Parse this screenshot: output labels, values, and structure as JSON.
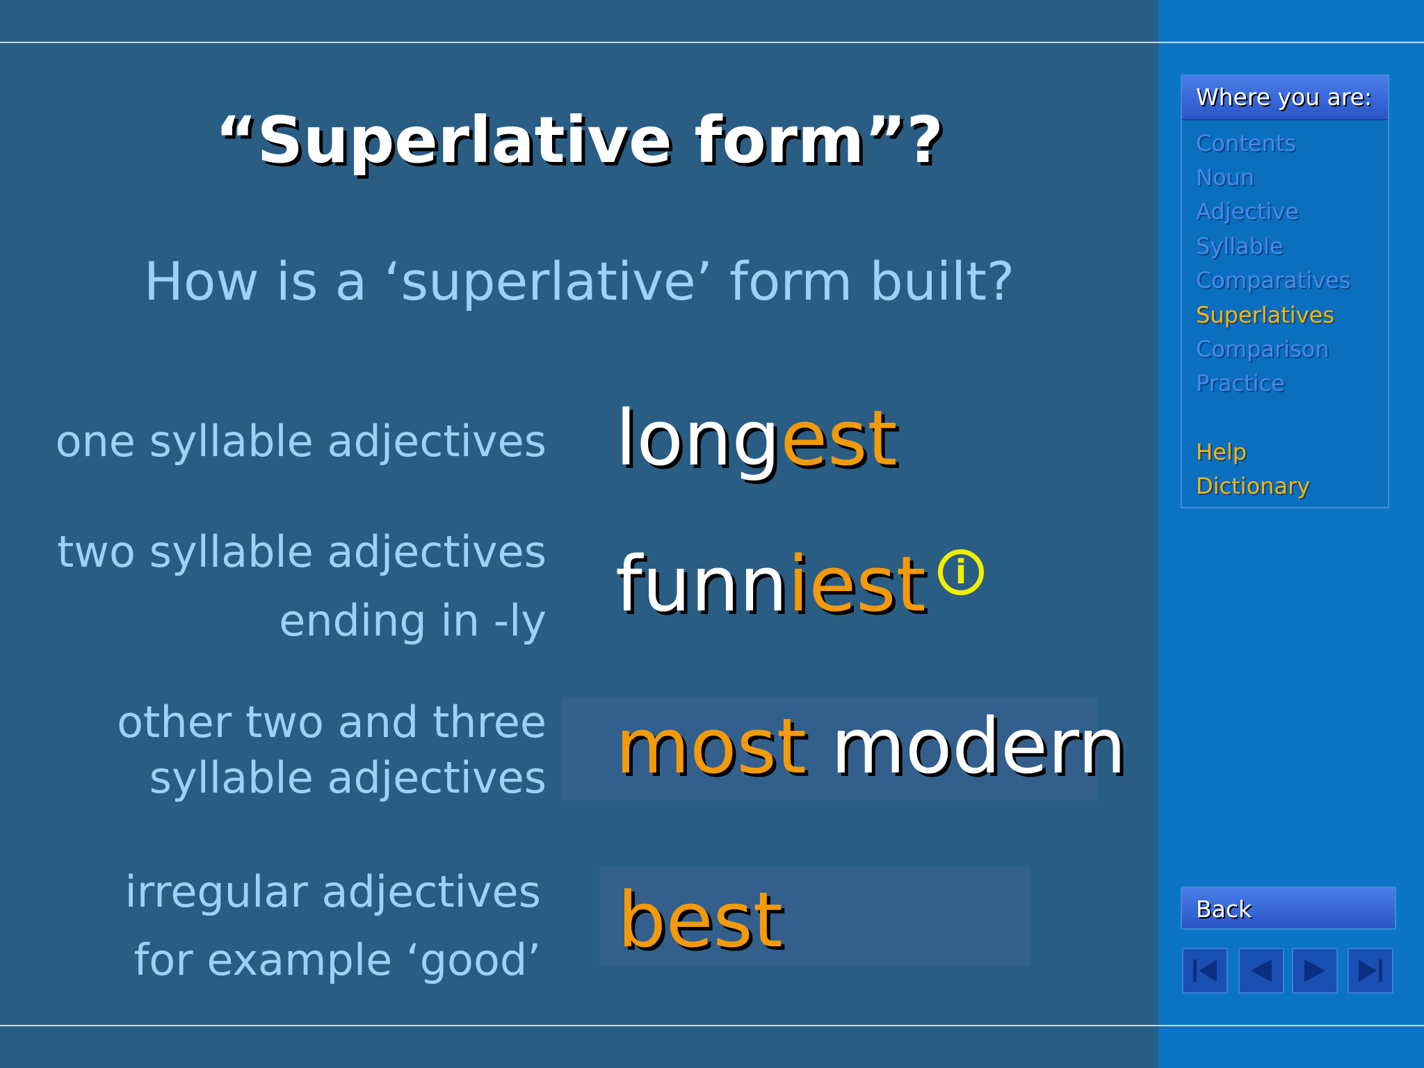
{
  "slide": {
    "title": "“Superlative form”?",
    "question": "How is a ‘superlative’ form built?"
  },
  "rows": {
    "one_label": "one syllable adjectives",
    "one_word_base": "long",
    "one_word_suffix": "est",
    "two_label_line1": "two syllable adjectives",
    "two_label_line2": "ending in -ly",
    "two_word_base": "funn",
    "two_word_suffix": "iest",
    "three_label_line1": "other two and three",
    "three_label_line2": "syllable adjectives",
    "three_word_prefix": "most",
    "three_word_base": "modern",
    "irr_label_line1": "irregular adjectives",
    "irr_label_line2": "for example ‘good’",
    "irr_word": "best"
  },
  "info_icon": "i",
  "sidebar": {
    "heading": "Where you are:",
    "items": [
      "Contents",
      "Noun",
      "Adjective",
      "Syllable",
      "Comparatives",
      "Superlatives",
      "Comparison",
      "Practice"
    ],
    "active_item": "Superlatives",
    "extra": [
      "Help",
      "Dictionary"
    ],
    "back_label": "Back",
    "nav_buttons": [
      "first-icon",
      "previous-icon",
      "next-icon",
      "last-icon"
    ]
  },
  "colors": {
    "background": "#2a5d84",
    "sidebar": "#0c74c4",
    "suffix": "#f39a0a",
    "label": "#9fd0fb",
    "active": "#ffb400"
  }
}
